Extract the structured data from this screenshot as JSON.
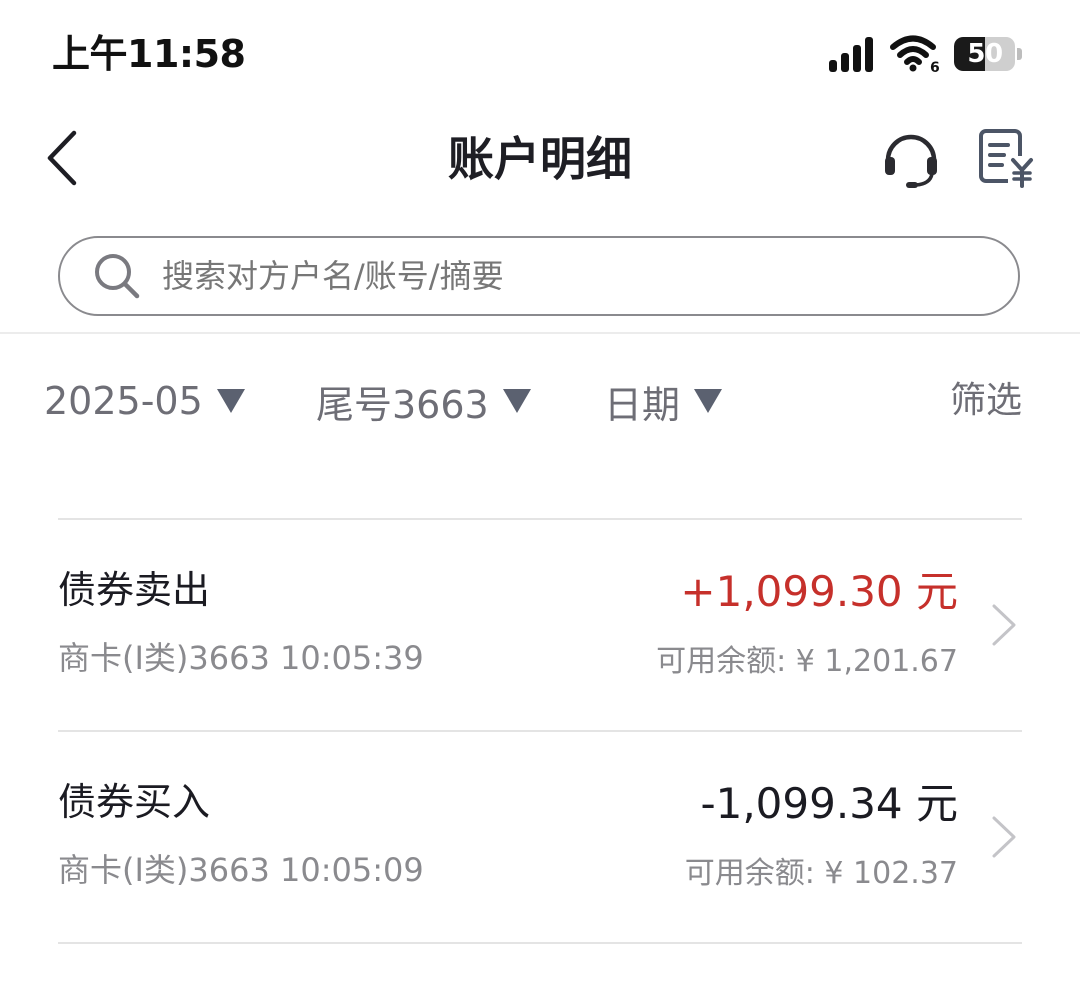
{
  "status_bar": {
    "time": "上午11:58",
    "battery_level": "50",
    "battery_fraction": 0.5,
    "wifi_label": "6"
  },
  "header": {
    "title": "账户明细",
    "back_icon": "chevron-left-icon",
    "service_icon": "headset-icon",
    "statement_icon": "bill-yuan-icon"
  },
  "search": {
    "placeholder": "搜索对方户名/账号/摘要",
    "value": ""
  },
  "filters": {
    "month": "2025-05",
    "card": "尾号3663",
    "sort": "日期",
    "screen": "筛选"
  },
  "colors": {
    "positive_amount": "#c6302b",
    "negative_amount": "#1b1b22",
    "secondary_text": "#8a8a8e"
  },
  "transactions": [
    {
      "title": "债券卖出",
      "meta": "商卡(I类)3663 10:05:39",
      "amount": "+1,099.30 元",
      "balance": "可用余额: ¥ 1,201.67",
      "direction": "positive"
    },
    {
      "title": "债券买入",
      "meta": "商卡(I类)3663 10:05:09",
      "amount": "-1,099.34 元",
      "balance": "可用余额: ¥ 102.37",
      "direction": "negative"
    }
  ]
}
